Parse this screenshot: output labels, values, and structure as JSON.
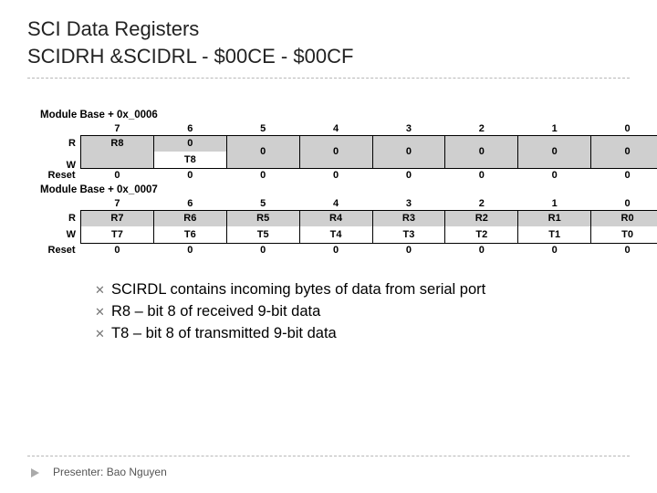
{
  "title": {
    "line1": "SCI Data Registers",
    "line2": "SCIDRH &SCIDRL - $00CE - $00CF"
  },
  "reg1": {
    "module_base": "Module Base + 0x_0006",
    "bits": [
      "7",
      "6",
      "5",
      "4",
      "3",
      "2",
      "1",
      "0"
    ],
    "read": [
      "R8",
      "0",
      "0",
      "0",
      "0",
      "0",
      "0",
      "0"
    ],
    "write": [
      "",
      "T8",
      "",
      "",
      "",
      "",
      "",
      "",
      ""
    ],
    "reset": [
      "0",
      "0",
      "0",
      "0",
      "0",
      "0",
      "0",
      "0"
    ],
    "rLabel": "R",
    "wLabel": "W",
    "resetLabel": "Reset"
  },
  "reg2": {
    "module_base": "Module Base + 0x_0007",
    "bits": [
      "7",
      "6",
      "5",
      "4",
      "3",
      "2",
      "1",
      "0"
    ],
    "read": [
      "R7",
      "R6",
      "R5",
      "R4",
      "R3",
      "R2",
      "R1",
      "R0"
    ],
    "write": [
      "T7",
      "T6",
      "T5",
      "T4",
      "T3",
      "T2",
      "T1",
      "T0"
    ],
    "reset": [
      "0",
      "0",
      "0",
      "0",
      "0",
      "0",
      "0",
      "0"
    ],
    "rLabel": "R",
    "wLabel": "W",
    "resetLabel": "Reset"
  },
  "bullets": [
    "SCIRDL contains incoming bytes of data from serial port",
    "R8 – bit 8 of received 9-bit data",
    "T8 – bit 8 of transmitted 9-bit data"
  ],
  "presenter": "Presenter: Bao Nguyen"
}
